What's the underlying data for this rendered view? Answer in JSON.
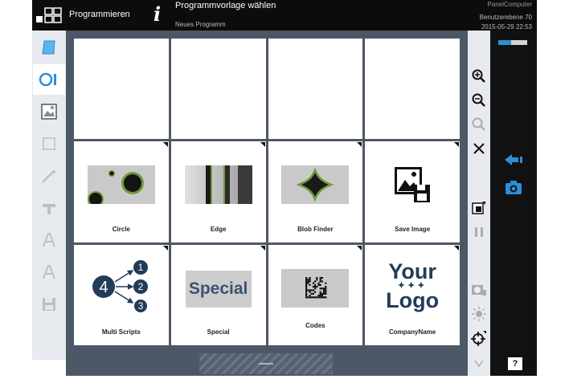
{
  "topbar": {
    "mode_label": "Programmieren",
    "title": "Programmvorlage wählen",
    "subtitle": "Neues Programm",
    "device": "PanelComputer",
    "user_level": "Benutzerebene 70",
    "datetime": "2015-05-29 22:53"
  },
  "templates": [
    {
      "label": "",
      "thumb": "empty"
    },
    {
      "label": "",
      "thumb": "empty"
    },
    {
      "label": "",
      "thumb": "empty"
    },
    {
      "label": "",
      "thumb": "empty"
    },
    {
      "label": "Circle",
      "thumb": "circle"
    },
    {
      "label": "Edge",
      "thumb": "edge"
    },
    {
      "label": "Blob Finder",
      "thumb": "blob"
    },
    {
      "label": "Save Image",
      "thumb": "save-image"
    },
    {
      "label": "Multi Scripts",
      "thumb": "multi-scripts",
      "diagram": {
        "source": "4",
        "targets": [
          "1",
          "2",
          "3"
        ]
      }
    },
    {
      "label": "Special",
      "thumb": "special",
      "thumb_text": "Special"
    },
    {
      "label": "Codes",
      "thumb": "codes"
    },
    {
      "label": "CompanyName",
      "thumb": "logo",
      "logo_line1": "Your",
      "logo_line2": "Logo"
    }
  ],
  "left_tools": [
    "page-icon",
    "circle-tool-icon",
    "image-icon",
    "crop-icon",
    "wand-icon",
    "tool-icon",
    "text-a-icon",
    "text-a2-icon",
    "save-icon"
  ],
  "right_tools": [
    "zoom-in-icon",
    "zoom-out-icon",
    "zoom-fit-icon",
    "close-icon",
    "layout-icon",
    "pause-icon",
    "camera-settings-icon",
    "brightness-icon",
    "target-icon",
    "scroll-down-icon"
  ],
  "side": {
    "help_label": "?",
    "battery_level": 0.45
  },
  "colors": {
    "accent_blue": "#2c8ed8",
    "frame": "#4d5866",
    "logo_navy": "#223b59",
    "ring_green": "#6f9a3a"
  }
}
